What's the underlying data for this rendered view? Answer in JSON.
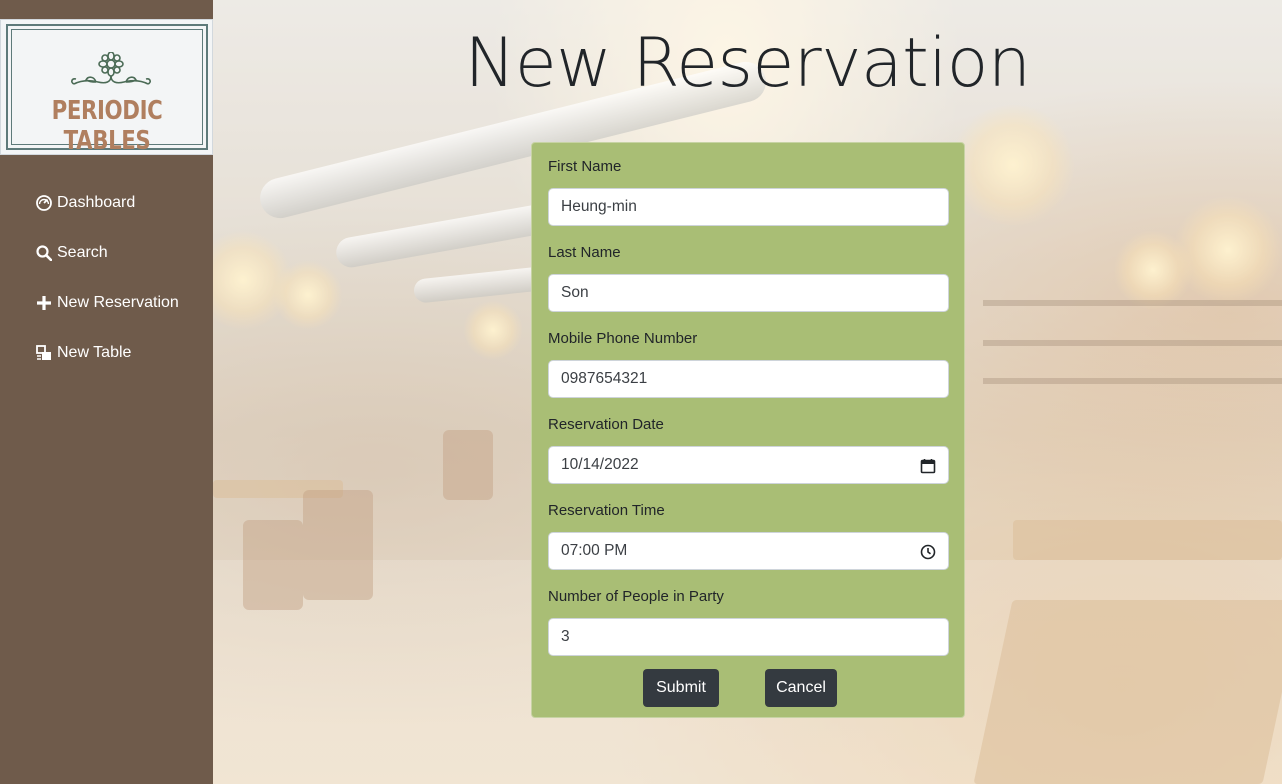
{
  "app": {
    "logo_text": "PERIODIC TABLES",
    "brand_color": "#b07f5f",
    "sidebar_color": "#6f5b4b"
  },
  "sidebar": {
    "items": [
      {
        "label": "Dashboard",
        "icon": "dashboard-icon"
      },
      {
        "label": "Search",
        "icon": "search-icon"
      },
      {
        "label": "New Reservation",
        "icon": "plus-icon"
      },
      {
        "label": "New Table",
        "icon": "table-icon"
      }
    ]
  },
  "page": {
    "title": "New Reservation"
  },
  "form": {
    "background_color": "#a9be75",
    "fields": [
      {
        "label": "First Name",
        "value": "Heung-min"
      },
      {
        "label": "Last Name",
        "value": "Son"
      },
      {
        "label": "Mobile Phone Number",
        "value": "0987654321"
      },
      {
        "label": "Reservation Date",
        "value": "10/14/2022",
        "icon": "calendar-icon"
      },
      {
        "label": "Reservation Time",
        "value": "07:00 PM",
        "icon": "clock-icon"
      },
      {
        "label": "Number of People in Party",
        "value": "3"
      }
    ],
    "submit_label": "Submit",
    "cancel_label": "Cancel"
  }
}
